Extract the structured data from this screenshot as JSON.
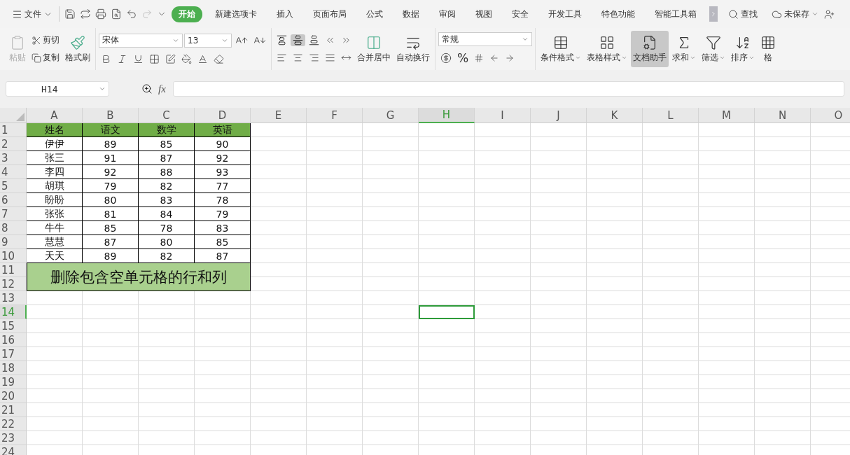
{
  "menu": {
    "label": "文件"
  },
  "tabs": [
    {
      "label": "开始",
      "selected": true
    },
    {
      "label": "新建选项卡",
      "selected": false
    },
    {
      "label": "插入",
      "selected": false
    },
    {
      "label": "页面布局",
      "selected": false
    },
    {
      "label": "公式",
      "selected": false
    },
    {
      "label": "数据",
      "selected": false
    },
    {
      "label": "审阅",
      "selected": false
    },
    {
      "label": "视图",
      "selected": false
    },
    {
      "label": "安全",
      "selected": false
    },
    {
      "label": "开发工具",
      "selected": false
    },
    {
      "label": "特色功能",
      "selected": false
    },
    {
      "label": "智能工具箱",
      "selected": false
    }
  ],
  "find": {
    "label": "查找"
  },
  "save_status": {
    "label": "未保存"
  },
  "ribbon": {
    "paste": {
      "label": "粘贴",
      "disabled": true
    },
    "cut": "剪切",
    "copy": "复制",
    "format_painter": "格式刷",
    "font_name": "宋体",
    "font_size": "13",
    "vertical_align": [
      {
        "selected": false
      },
      {
        "selected": true
      },
      {
        "selected": false
      }
    ],
    "merge": "合并居中",
    "wrap": "自动换行",
    "number_format": "常规",
    "percent": "%",
    "tools": [
      {
        "kind": "conditional",
        "label": "条件格式",
        "selected": false,
        "dropdown": true
      },
      {
        "kind": "table_style",
        "label": "表格样式",
        "selected": false,
        "dropdown": true
      },
      {
        "kind": "assistant",
        "label": "文档助手",
        "selected": true,
        "dropdown": false
      },
      {
        "kind": "sum",
        "label": "求和",
        "selected": false,
        "dropdown": true
      },
      {
        "kind": "filter",
        "label": "筛选",
        "selected": false,
        "dropdown": true
      },
      {
        "kind": "sort",
        "label": "排序",
        "selected": false,
        "dropdown": true
      },
      {
        "kind": "format",
        "label": "格",
        "selected": false,
        "dropdown": false
      }
    ]
  },
  "name_box": "H14",
  "formula_label": "fx",
  "sheet": {
    "columns": [
      {
        "label": "A",
        "selected": false
      },
      {
        "label": "B",
        "selected": false
      },
      {
        "label": "C",
        "selected": false
      },
      {
        "label": "D",
        "selected": false
      },
      {
        "label": "E",
        "selected": false
      },
      {
        "label": "F",
        "selected": false
      },
      {
        "label": "G",
        "selected": false
      },
      {
        "label": "H",
        "selected": true
      },
      {
        "label": "I",
        "selected": false
      },
      {
        "label": "J",
        "selected": false
      },
      {
        "label": "K",
        "selected": false
      },
      {
        "label": "L",
        "selected": false
      },
      {
        "label": "M",
        "selected": false
      },
      {
        "label": "N",
        "selected": false
      },
      {
        "label": "O",
        "selected": false
      }
    ],
    "rows": [
      {
        "label": "1",
        "selected": false
      },
      {
        "label": "2",
        "selected": false
      },
      {
        "label": "3",
        "selected": false
      },
      {
        "label": "4",
        "selected": false
      },
      {
        "label": "5",
        "selected": false
      },
      {
        "label": "6",
        "selected": false
      },
      {
        "label": "7",
        "selected": false
      },
      {
        "label": "8",
        "selected": false
      },
      {
        "label": "9",
        "selected": false
      },
      {
        "label": "10",
        "selected": false
      },
      {
        "label": "11",
        "selected": false
      },
      {
        "label": "12",
        "selected": false
      },
      {
        "label": "13",
        "selected": false
      },
      {
        "label": "14",
        "selected": true
      },
      {
        "label": "15",
        "selected": false
      },
      {
        "label": "16",
        "selected": false
      },
      {
        "label": "17",
        "selected": false
      },
      {
        "label": "18",
        "selected": false
      },
      {
        "label": "19",
        "selected": false
      },
      {
        "label": "20",
        "selected": false
      },
      {
        "label": "21",
        "selected": false
      },
      {
        "label": "22",
        "selected": false
      },
      {
        "label": "23",
        "selected": false
      },
      {
        "label": "24",
        "selected": false
      }
    ]
  },
  "table": {
    "header": [
      "姓名",
      "语文",
      "数学",
      "英语"
    ],
    "rows": [
      [
        "伊伊",
        "89",
        "85",
        "90"
      ],
      [
        "张三",
        "91",
        "87",
        "92"
      ],
      [
        "李四",
        "92",
        "88",
        "93"
      ],
      [
        "胡琪",
        "79",
        "82",
        "77"
      ],
      [
        "盼盼",
        "80",
        "83",
        "78"
      ],
      [
        "张张",
        "81",
        "84",
        "79"
      ],
      [
        "牛牛",
        "85",
        "78",
        "83"
      ],
      [
        "慧慧",
        "87",
        "80",
        "85"
      ],
      [
        "天天",
        "89",
        "82",
        "87"
      ]
    ],
    "note": "删除包含空单元格的行和列"
  }
}
